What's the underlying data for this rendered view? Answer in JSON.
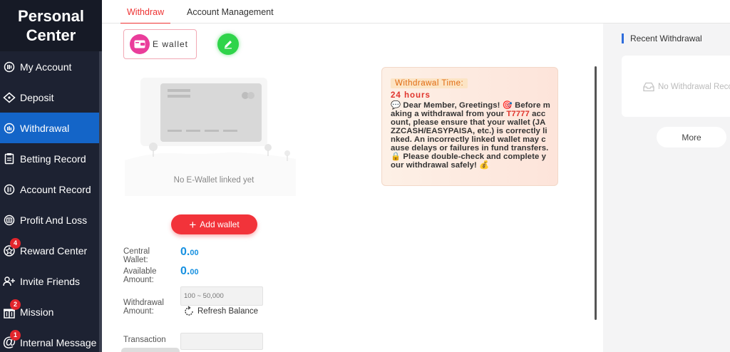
{
  "sidebar": {
    "title_line1": "Personal",
    "title_line2": "Center",
    "items": [
      {
        "label": "My Account",
        "icon": "wallet-circle-icon",
        "active": false
      },
      {
        "label": "Deposit",
        "icon": "ticket-icon",
        "active": false
      },
      {
        "label": "Withdrawal",
        "icon": "withdraw-circle-icon",
        "active": true
      },
      {
        "label": "Betting Record",
        "icon": "clipboard-icon",
        "active": false
      },
      {
        "label": "Account Record",
        "icon": "list-circle-icon",
        "active": false
      },
      {
        "label": "Profit And Loss",
        "icon": "chart-circle-icon",
        "active": false
      },
      {
        "label": "Reward Center",
        "icon": "reward-icon",
        "active": false,
        "badge": "4"
      },
      {
        "label": "Invite Friends",
        "icon": "invite-icon",
        "active": false
      },
      {
        "label": "Mission",
        "icon": "gift-icon",
        "active": false,
        "badge": "2"
      },
      {
        "label": "Internal Message",
        "icon": "at-icon",
        "active": false,
        "badge": "1"
      }
    ]
  },
  "tabs": [
    {
      "label": "Withdraw",
      "active": true
    },
    {
      "label": "Account Management",
      "active": false
    }
  ],
  "main": {
    "ewallet_label": "E wallet",
    "no_wallet_text": "No E-Wallet linked yet",
    "add_wallet_label": "Add wallet",
    "central_wallet_label": "Central Wallet:",
    "central_wallet_int": "0.",
    "central_wallet_dec": "00",
    "available_label": "Available Amount:",
    "available_int": "0.",
    "available_dec": "00",
    "withdrawal_amount_label": "Withdrawal Amount:",
    "withdrawal_placeholder": "100 ~ 50,000",
    "refresh_label": "Refresh Balance",
    "transaction_label": "Transaction"
  },
  "notice": {
    "title": "Withdrawal Time:",
    "hours": "24 hours",
    "p1_before": "Dear Member, Greetings!",
    "p1_mid": "Before making a withdrawal from your",
    "p1_brand": "T7777",
    "p1_after": "account, please ensure that your wallet (JAZZCASH/EASYPAISA, etc.) is correctly linked. An incorrectly linked wallet may cause delays or failures in fund transfers.",
    "p2": "Please double-check and complete your withdrawal safely!"
  },
  "right": {
    "recent_title": "Recent Withdrawal",
    "empty_text": "No Withdrawal Records",
    "more_label": "More"
  },
  "colors": {
    "sidebar_bg": "#1d2232",
    "active_blue": "#1465c8",
    "accent_red": "#f2333a",
    "amount_blue": "#1690e0",
    "edit_green": "#2fd44a"
  }
}
